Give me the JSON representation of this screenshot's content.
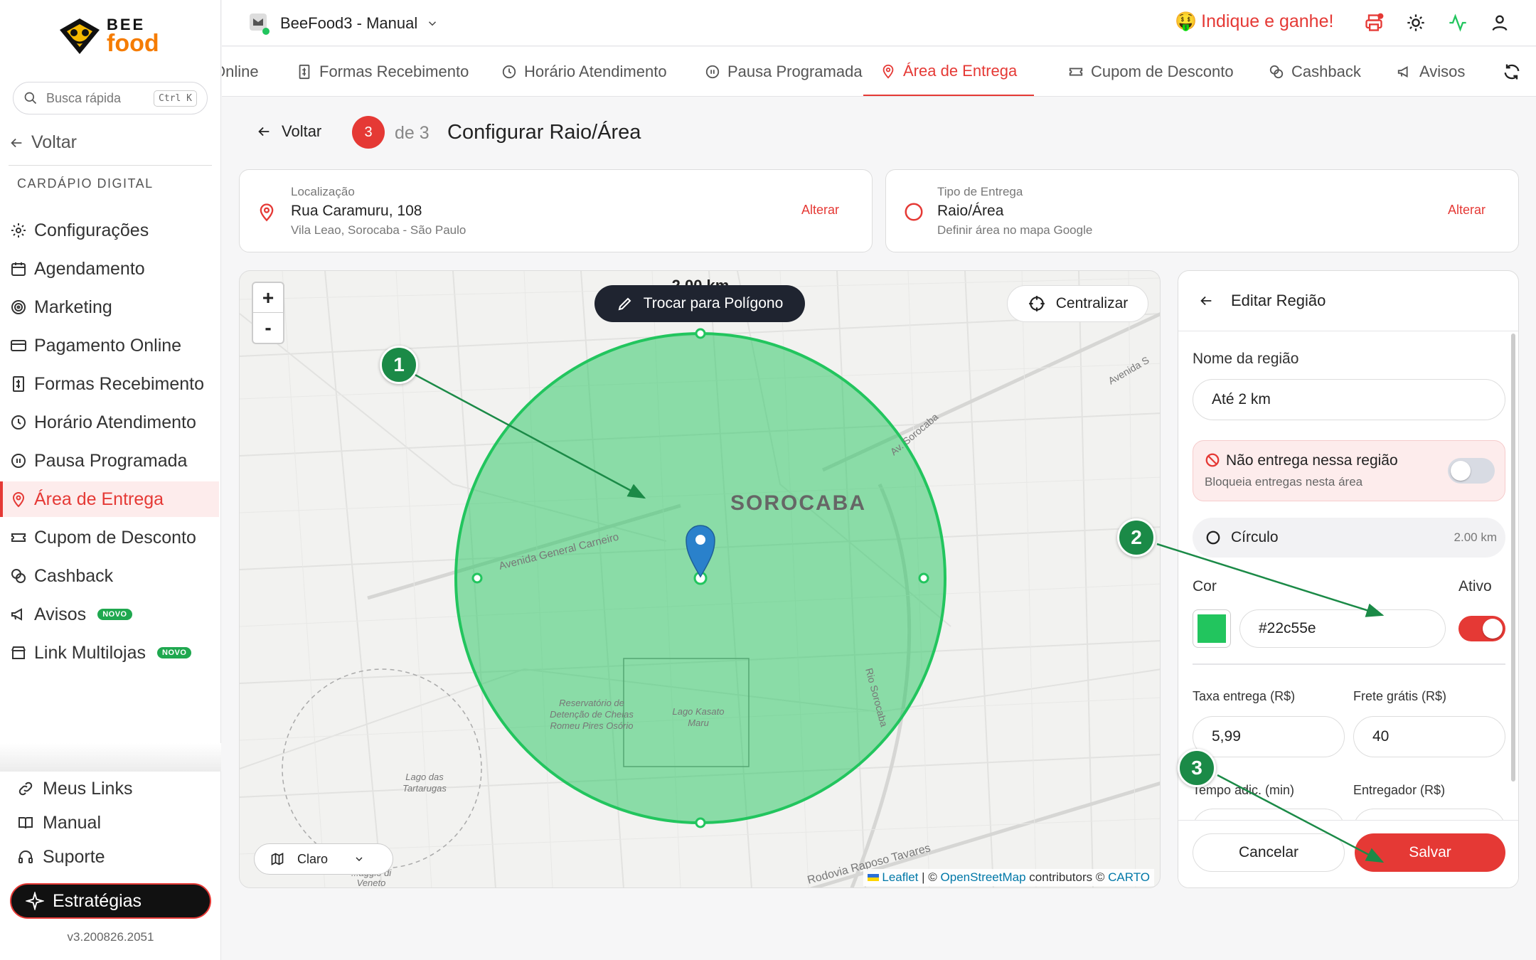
{
  "brand": {
    "name_top": "BEE",
    "name_bottom": "food"
  },
  "sidebar": {
    "search_placeholder": "Busca rápida",
    "search_shortcut": "Ctrl K",
    "back_label": "Voltar",
    "section_label": "CARDÁPIO DIGITAL",
    "items": [
      {
        "label": "Configurações",
        "icon": "gear-icon"
      },
      {
        "label": "Agendamento",
        "icon": "calendar-icon"
      },
      {
        "label": "Marketing",
        "icon": "target-icon"
      },
      {
        "label": "Pagamento Online",
        "icon": "card-icon"
      },
      {
        "label": "Formas Recebimento",
        "icon": "receipt-icon"
      },
      {
        "label": "Horário Atendimento",
        "icon": "clock-icon"
      },
      {
        "label": "Pausa Programada",
        "icon": "pause-icon"
      },
      {
        "label": "Área de Entrega",
        "icon": "map-pin-icon",
        "active": true
      },
      {
        "label": "Cupom de Desconto",
        "icon": "ticket-icon"
      },
      {
        "label": "Cashback",
        "icon": "coins-icon"
      },
      {
        "label": "Avisos",
        "icon": "megaphone-icon",
        "badge": "NOVO"
      },
      {
        "label": "Link Multilojas",
        "icon": "store-icon",
        "badge": "NOVO"
      }
    ],
    "bottom": [
      {
        "label": "Meus Links",
        "icon": "link-icon"
      },
      {
        "label": "Manual",
        "icon": "book-icon"
      },
      {
        "label": "Suporte",
        "icon": "headset-icon"
      }
    ],
    "strategies_label": "Estratégias",
    "version": "v3.200826.2051"
  },
  "topbar": {
    "store_name": "BeeFood3 - Manual",
    "referral": "Indique e ganhe!",
    "referral_emoji": "🤑"
  },
  "tabs": [
    {
      "label": "Online"
    },
    {
      "label": "Formas Recebimento"
    },
    {
      "label": "Horário Atendimento"
    },
    {
      "label": "Pausa Programada"
    },
    {
      "label": "Área de Entrega",
      "active": true
    },
    {
      "label": "Cupom de Desconto"
    },
    {
      "label": "Cashback"
    },
    {
      "label": "Avisos"
    }
  ],
  "step": {
    "back_label": "Voltar",
    "current": "3",
    "of": "de 3",
    "title": "Configurar Raio/Área"
  },
  "location_card": {
    "label": "Localização",
    "value": "Rua Caramuru, 108",
    "sub": "Vila Leao, Sorocaba - São Paulo",
    "action": "Alterar"
  },
  "delivery_card": {
    "label": "Tipo de Entrega",
    "value": "Raio/Área",
    "sub": "Definir área no mapa Google",
    "action": "Alterar"
  },
  "map": {
    "radius_label": "2.00 km",
    "switch_button": "Trocar para Polígono",
    "center_button": "Centralizar",
    "zoom_in": "+",
    "zoom_out": "-",
    "layer_value": "Claro",
    "city_label": "SOROCABA",
    "street_labels": [
      "Avenida General Carneiro",
      "Rodovia Raposo Tavares",
      "Av. Sorocaba",
      "Avenida S",
      "Rio Sorocaba"
    ],
    "place_labels": [
      "Reservatório de Detenção de Cheias Romeu Pires Osório",
      "Lago Kasato Maru",
      "Lago das Tartarugas",
      "...aggio di Veneto"
    ],
    "attribution": {
      "leaflet": "Leaflet",
      "sep": "| ©",
      "osm": "OpenStreetMap",
      "contrib": "contributors ©",
      "carto": "CARTO"
    },
    "circle_color": "#22c55e"
  },
  "panel": {
    "title": "Editar Região",
    "region_name_label": "Nome da região",
    "region_name_value": "Até 2 km",
    "no_delivery_title": "Não entrega nessa região",
    "no_delivery_sub": "Bloqueia entregas nesta área",
    "no_delivery_on": false,
    "shape_label": "Círculo",
    "shape_radius": "2.00 km",
    "color_label": "Cor",
    "color_value": "#22c55e",
    "active_label": "Ativo",
    "active_on": true,
    "fee_label": "Taxa entrega (R$)",
    "fee_value": "5,99",
    "free_label": "Frete grátis (R$)",
    "free_value": "40",
    "time_label": "Tempo adic. (min)",
    "courier_label": "Entregador (R$)",
    "cancel_label": "Cancelar",
    "save_label": "Salvar"
  },
  "annotations": [
    {
      "label": "1"
    },
    {
      "label": "2"
    },
    {
      "label": "3"
    }
  ],
  "colors": {
    "accent": "#e53935",
    "map_circle": "#22c55e",
    "annotation": "#1b8a47"
  }
}
